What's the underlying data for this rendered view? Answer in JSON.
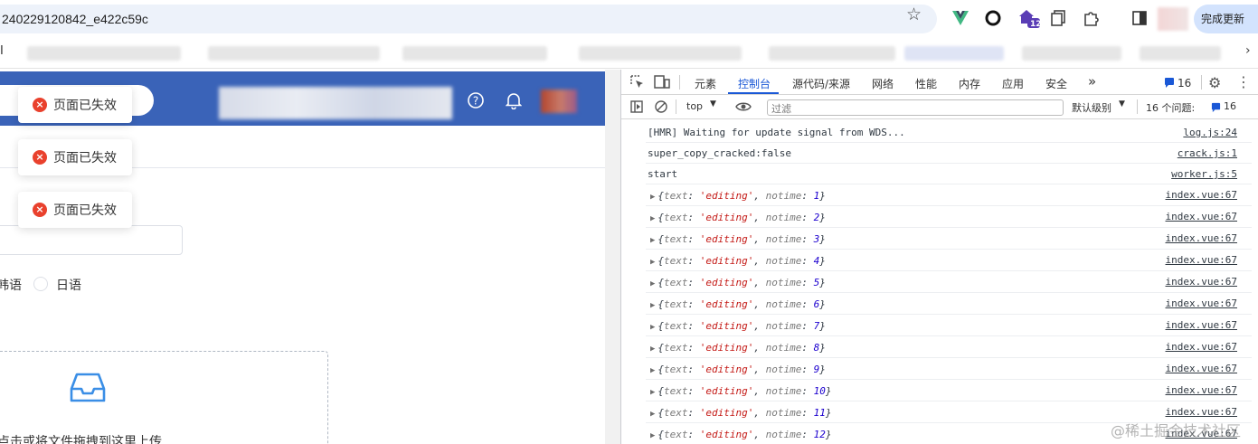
{
  "browser": {
    "url": "240229120842_e422c59c",
    "update_button": "完成更新",
    "bookmark_mark": "I",
    "tab_badge": "12"
  },
  "page": {
    "toasts": [
      {
        "icon": "×",
        "text": "页面已失效"
      },
      {
        "icon": "×",
        "text": "页面已失效"
      },
      {
        "icon": "×",
        "text": "页面已失效"
      }
    ],
    "radio_left": "韩语",
    "radio_right": "日语",
    "upload_text": "点击或将文件拖拽到这里上传"
  },
  "devtools": {
    "tabs": [
      "元素",
      "控制台",
      "源代码/来源",
      "网络",
      "性能",
      "内存",
      "应用",
      "安全",
      "»"
    ],
    "active_tab": "控制台",
    "message_count": "16",
    "context": "top",
    "filter_placeholder": "过滤",
    "level": "默认级别",
    "issues_label": "16 个问题:",
    "issues_count": "16",
    "logs": [
      {
        "text": "[HMR] Waiting for update signal from WDS...",
        "source": "log.js:24"
      },
      {
        "text": "super_copy_cracked:false",
        "source": "crack.js:1"
      },
      {
        "text": "start",
        "source": "worker.js:5"
      }
    ],
    "objects": [
      {
        "text_value": "'editing'",
        "notime": "1",
        "source": "index.vue:67"
      },
      {
        "text_value": "'editing'",
        "notime": "2",
        "source": "index.vue:67"
      },
      {
        "text_value": "'editing'",
        "notime": "3",
        "source": "index.vue:67"
      },
      {
        "text_value": "'editing'",
        "notime": "4",
        "source": "index.vue:67"
      },
      {
        "text_value": "'editing'",
        "notime": "5",
        "source": "index.vue:67"
      },
      {
        "text_value": "'editing'",
        "notime": "6",
        "source": "index.vue:67"
      },
      {
        "text_value": "'editing'",
        "notime": "7",
        "source": "index.vue:67"
      },
      {
        "text_value": "'editing'",
        "notime": "8",
        "source": "index.vue:67"
      },
      {
        "text_value": "'editing'",
        "notime": "9",
        "source": "index.vue:67"
      },
      {
        "text_value": "'editing'",
        "notime": "10",
        "source": "index.vue:67"
      },
      {
        "text_value": "'editing'",
        "notime": "11",
        "source": "index.vue:67"
      },
      {
        "text_value": "'editing'",
        "notime": "12",
        "source": "index.vue:67"
      }
    ]
  },
  "watermark": "@稀土掘金技术社区",
  "colors": {
    "header_blue": "#3a63b8",
    "toast_error": "#e9412d",
    "devtools_active": "#1a58d6",
    "string_red": "#c41a16",
    "number_blue": "#1c00cf"
  }
}
